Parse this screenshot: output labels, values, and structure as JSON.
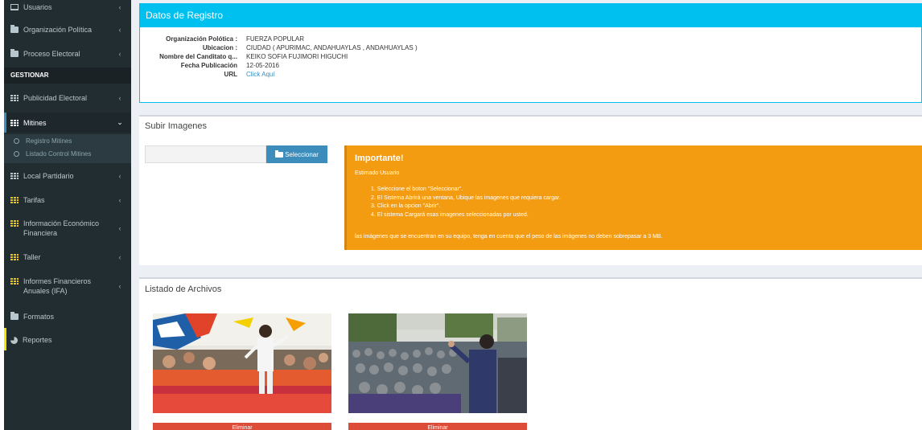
{
  "sidebar": {
    "items": [
      {
        "label": "Usuarios",
        "icon": "laptop-icon"
      },
      {
        "label": "Organización Política",
        "icon": "folder-icon"
      },
      {
        "label": "Proceso Electoral",
        "icon": "folder-icon"
      },
      {
        "label": "Publicidad Electoral",
        "icon": "grid-icon"
      },
      {
        "label": "Mitines",
        "icon": "grid-icon"
      },
      {
        "label": "Local Partidario",
        "icon": "grid-icon"
      },
      {
        "label": "Tarifas",
        "icon": "grid-icon"
      },
      {
        "label": "Información Económico Financiera",
        "icon": "grid-icon"
      },
      {
        "label": "Taller",
        "icon": "grid-icon"
      },
      {
        "label": "Informes Financieros Anuales (IFA)",
        "icon": "grid-icon"
      },
      {
        "label": "Formatos",
        "icon": "folder-icon"
      },
      {
        "label": "Reportes",
        "icon": "pie-chart-icon"
      }
    ],
    "header": "GESTIONAR",
    "sub_items": [
      "Registro Mitines",
      "Listado Control Mitines"
    ],
    "chevron_right": "‹",
    "chevron_down": "⌄"
  },
  "registro": {
    "title": "Datos de Registro",
    "fields": [
      {
        "key": "Organización Polótica :",
        "value": "FUERZA POPULAR"
      },
      {
        "key": "Ubicacion :",
        "value": "CIUDAD ( APURIMAC, ANDAHUAYLAS , ANDAHUAYLAS )"
      },
      {
        "key": "Nombre del Canditato q...",
        "value": "KEIKO SOFIA FUJIMORI HIGUCHI"
      },
      {
        "key": "Fecha Publicación",
        "value": "12-05-2016"
      },
      {
        "key": "URL",
        "value": "Click Aquí"
      }
    ]
  },
  "upload": {
    "title": "Subir Imagenes",
    "button_label": "Seleccionar"
  },
  "alert": {
    "title": "Importante!",
    "intro": "Estimado Usuario",
    "steps": [
      "1. Seleccione el boton \"Seleccionar\".",
      "2. El Sistema Abrirá una ventana, Ubique las imagenes que requiera cargar.",
      "3. Click en la opcion \"Abrir\".",
      "4. El sistema Cargará esas imagenes seleccionadas por usted."
    ],
    "note": "las imágenes que se encuentran en su equipo, tenga en cuenta que el peso de las imágenes no deben sobrepasar a 3 MB."
  },
  "files": {
    "title": "Listado de Archivos",
    "delete_label": "Eliminar"
  },
  "colors": {
    "sidebar_bg": "#222d32",
    "info_blue": "#00c0ef",
    "primary": "#3c8dbc",
    "warning": "#f39c12",
    "danger": "#dd4b39",
    "icon_yellow": "#f5c400"
  }
}
